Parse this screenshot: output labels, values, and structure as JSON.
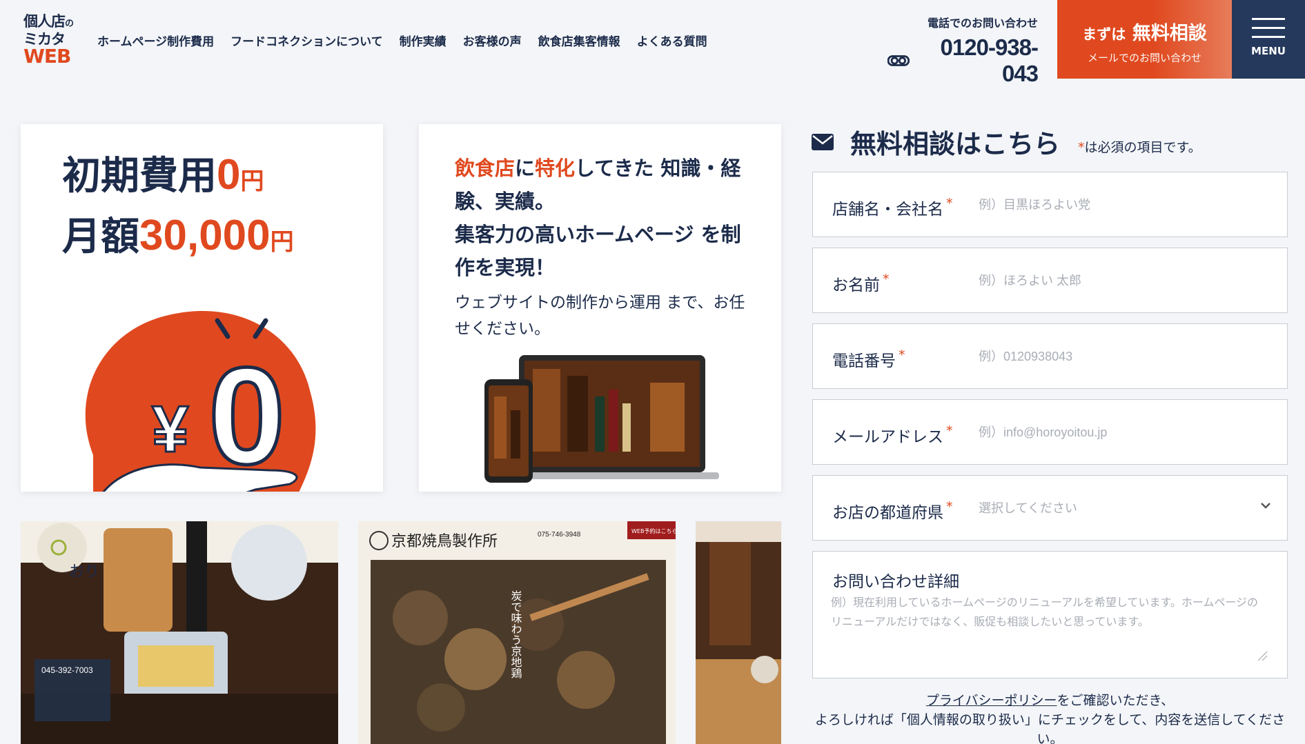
{
  "logo": {
    "line1": "個人店",
    "line1_suffix": "の",
    "line2": "ミカタ",
    "line3": "WEB"
  },
  "nav": [
    "ホームページ制作費用",
    "フードコネクションについて",
    "制作実績",
    "お客様の声",
    "飲食店集客情報",
    "よくある質問"
  ],
  "tel": {
    "label": "電話でのお問い合わせ",
    "number": "0120-938-043",
    "icon": "free-dial-icon"
  },
  "cta": {
    "prefix": "まずは",
    "main": "無料相談",
    "sub": "メールでのお問い合わせ"
  },
  "menu": {
    "label": "MENU"
  },
  "pricing": {
    "initial_label": "初期費用",
    "initial_value": "0",
    "initial_unit": "円",
    "monthly_label": "月額",
    "monthly_value": "30,000",
    "monthly_unit": "円",
    "illustration": {
      "yen_symbol": "¥",
      "zero": "0"
    }
  },
  "feature": {
    "hl1": "飲食店",
    "t1": "に",
    "hl2": "特化",
    "t2": "してきた 知識・経験、実績。",
    "t3": "集客力の高いホームページ を制作を実現！",
    "sub": "ウェブサイトの制作から運用 まで、お任せください。"
  },
  "gallery": {
    "shot1": {
      "sign": "おり",
      "tel": "045-392-7003"
    },
    "shot2": {
      "brand": "京都焼鳥製作所",
      "tel": "075-746-3948",
      "tagline": "炭で味わう京地鶏",
      "reserve": "WEB予約はこちら"
    }
  },
  "form": {
    "title": "無料相談はこちら",
    "required_star": "*",
    "required_note": "は必須の項目です。",
    "fields": [
      {
        "label": "店舗名・会社名",
        "placeholder": "例）目黒ほろよい党"
      },
      {
        "label": "お名前",
        "placeholder": "例）ほろよい 太郎"
      },
      {
        "label": "電話番号",
        "placeholder": "例）0120938043"
      },
      {
        "label": "メールアドレス",
        "placeholder": "例）info@horoyoitou.jp"
      }
    ],
    "prefecture": {
      "label": "お店の都道府県",
      "placeholder": "選択してください"
    },
    "details": {
      "label": "お問い合わせ詳細",
      "placeholder": "例）現在利用しているホームページのリニューアルを希望しています。ホームページのリニューアルだけではなく、販促も相談したいと思っています。"
    },
    "privacy_link": "プライバシーポリシー",
    "privacy_text1": "をご確認いただき、",
    "privacy_text2": "よろしければ「個人情報の取り扱い」にチェックをして、内容を送信してください。"
  },
  "colors": {
    "accent": "#e0491f",
    "navy": "#1c2b4a",
    "menu_bg": "#24395c",
    "background": "#f3f5f8"
  }
}
